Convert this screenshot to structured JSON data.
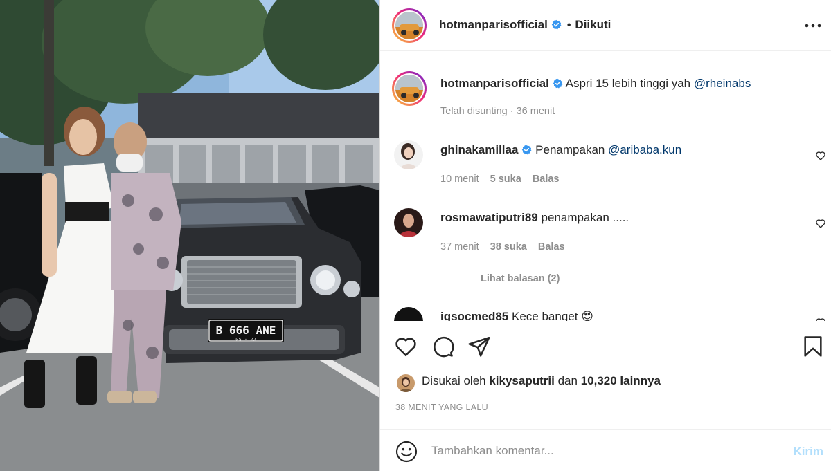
{
  "post": {
    "username": "hotmanparisofficial",
    "follow_status": "Diikuti",
    "separator": "•",
    "more_label": "Opsi lainnya"
  },
  "caption": {
    "username": "hotmanparisofficial",
    "text": "Aspri 15 lebih tinggi yah",
    "mention": "@rheinabs",
    "meta": "Telah disunting · 36 menit"
  },
  "comments": [
    {
      "username": "ghinakamillaa",
      "verified": true,
      "text": "Penampakan",
      "mention": "@aribaba.kun",
      "time": "10 menit",
      "likes": "5 suka",
      "reply": "Balas"
    },
    {
      "username": "rosmawatiputri89",
      "verified": false,
      "text": "penampakan .....",
      "mention": "",
      "time": "37 menit",
      "likes": "38 suka",
      "reply": "Balas",
      "view_replies": "Lihat balasan (2)"
    },
    {
      "username": "igsocmed85",
      "verified": false,
      "text": "Kece banget",
      "emoji": "😍"
    }
  ],
  "engagement": {
    "liked_by_prefix": "Disukai oleh",
    "liked_by_user": "kikysaputrii",
    "liked_by_and": "dan",
    "liked_by_count": "10,320 lainnya",
    "timestamp": "38 MENIT YANG LALU"
  },
  "composer": {
    "placeholder": "Tambahkan komentar...",
    "post_label": "Kirim"
  },
  "photo": {
    "plate_number": "B  666  ANE",
    "plate_sub": "05 · 22"
  },
  "colors": {
    "verified_blue": "#3897f0",
    "mention_blue": "#00376b",
    "muted": "#8e8e8e",
    "post_button_disabled": "#b2dffc"
  }
}
